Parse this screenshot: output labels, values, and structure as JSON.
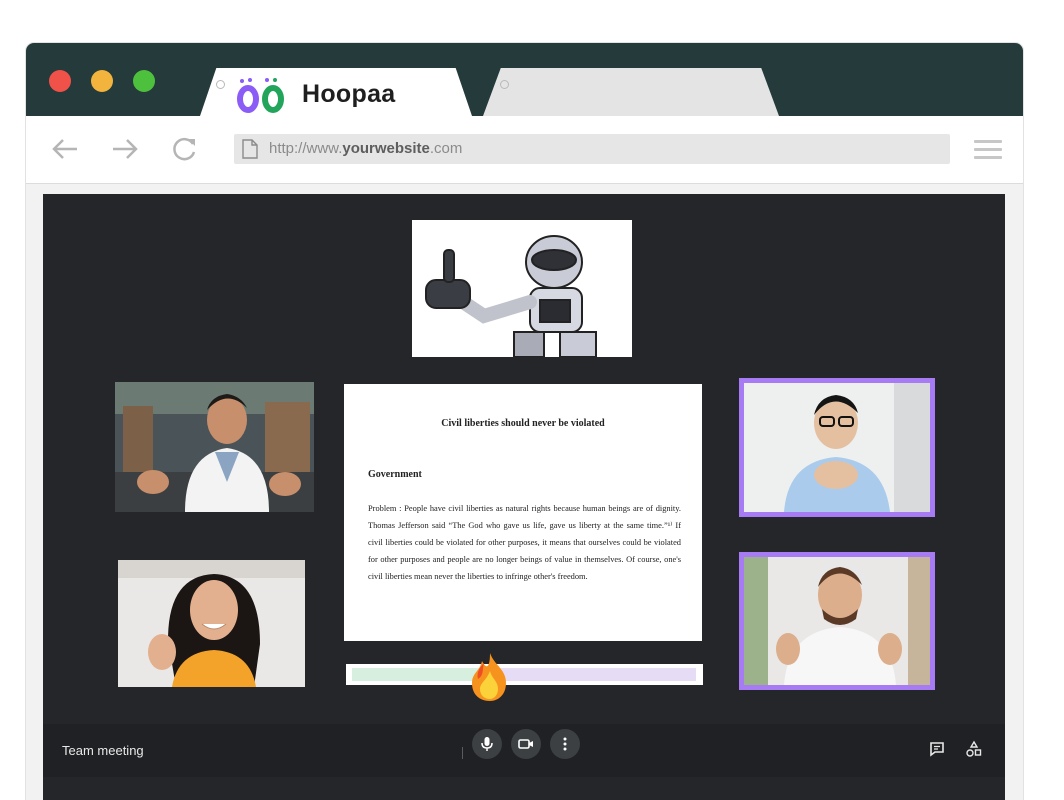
{
  "browser": {
    "controls": [
      "close",
      "minimize",
      "maximize"
    ],
    "active_tab": {
      "title": "Hoopaa",
      "icon": "hoopaa-logo"
    },
    "inactive_tab": {
      "title": ""
    },
    "address_bar": {
      "prefix": "http://www.",
      "domain": "yourwebsite",
      "suffix": ".com"
    },
    "nav_icons": [
      "back-arrow-icon",
      "forward-arrow-icon",
      "reload-icon",
      "page-icon",
      "menu-icon"
    ]
  },
  "meeting": {
    "name": "Team meeting",
    "participants": [
      {
        "description": "robot",
        "highlighted": false
      },
      {
        "description": "doctor",
        "highlighted": false
      },
      {
        "description": "woman-waving",
        "highlighted": false
      },
      {
        "description": "man-with-glasses",
        "highlighted": true
      },
      {
        "description": "man-with-headphones",
        "highlighted": true
      }
    ],
    "document": {
      "title": "Civil liberties should never be violated",
      "heading": "Government",
      "body": "Problem : People have civil liberties as natural rights because human beings are of dignity. Thomas Jefferson said “The God who gave us life, gave us liberty at the same time.”¹⁾ If civil liberties could be violated for other purposes, it means that ourselves could be violated for other purposes and people are no longer beings of value in themselves. Of course, one's civil liberties mean never the liberties to infringe other's freedom."
    },
    "progress": {
      "fraction": 0.4
    },
    "controls": [
      "microphone-icon",
      "camera-icon",
      "more-options-icon"
    ],
    "side_actions": [
      "chat-icon",
      "activities-icon"
    ]
  },
  "colors": {
    "titlebar": "#253a3a",
    "stage": "#24262a",
    "highlight": "#a77bf3"
  }
}
